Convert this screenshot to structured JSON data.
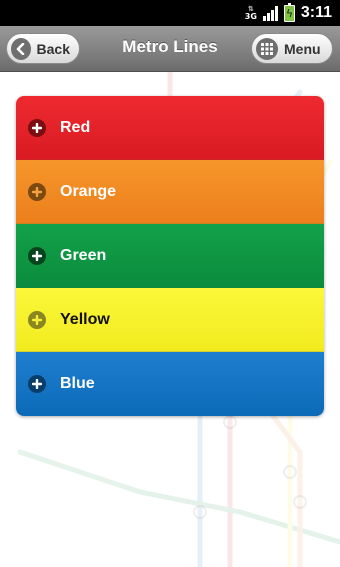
{
  "status_bar": {
    "network": "3G",
    "time": "3:11"
  },
  "header": {
    "back_label": "Back",
    "title": "Metro Lines",
    "menu_label": "Menu"
  },
  "lines": [
    {
      "label": "Red",
      "color_top": "#ee2a30",
      "color_bottom": "#d91a22",
      "text_color": "#ffffff",
      "icon_bg": "#7a0e12",
      "icon_fg": "#ffffff"
    },
    {
      "label": "Orange",
      "color_top": "#f6962a",
      "color_bottom": "#ec7f1c",
      "text_color": "#ffffff",
      "icon_bg": "#7b4a10",
      "icon_fg": "#f6a13e"
    },
    {
      "label": "Green",
      "color_top": "#13a14a",
      "color_bottom": "#0a8c3c",
      "text_color": "#ffffff",
      "icon_bg": "#06441d",
      "icon_fg": "#ffffff"
    },
    {
      "label": "Yellow",
      "color_top": "#fbf73a",
      "color_bottom": "#f1eb1e",
      "text_color": "#111111",
      "icon_bg": "#8a8620",
      "icon_fg": "#f4ef3a"
    },
    {
      "label": "Blue",
      "color_top": "#1f7fcf",
      "color_bottom": "#0b6ab8",
      "text_color": "#ffffff",
      "icon_bg": "#083e6b",
      "icon_fg": "#ffffff"
    }
  ]
}
